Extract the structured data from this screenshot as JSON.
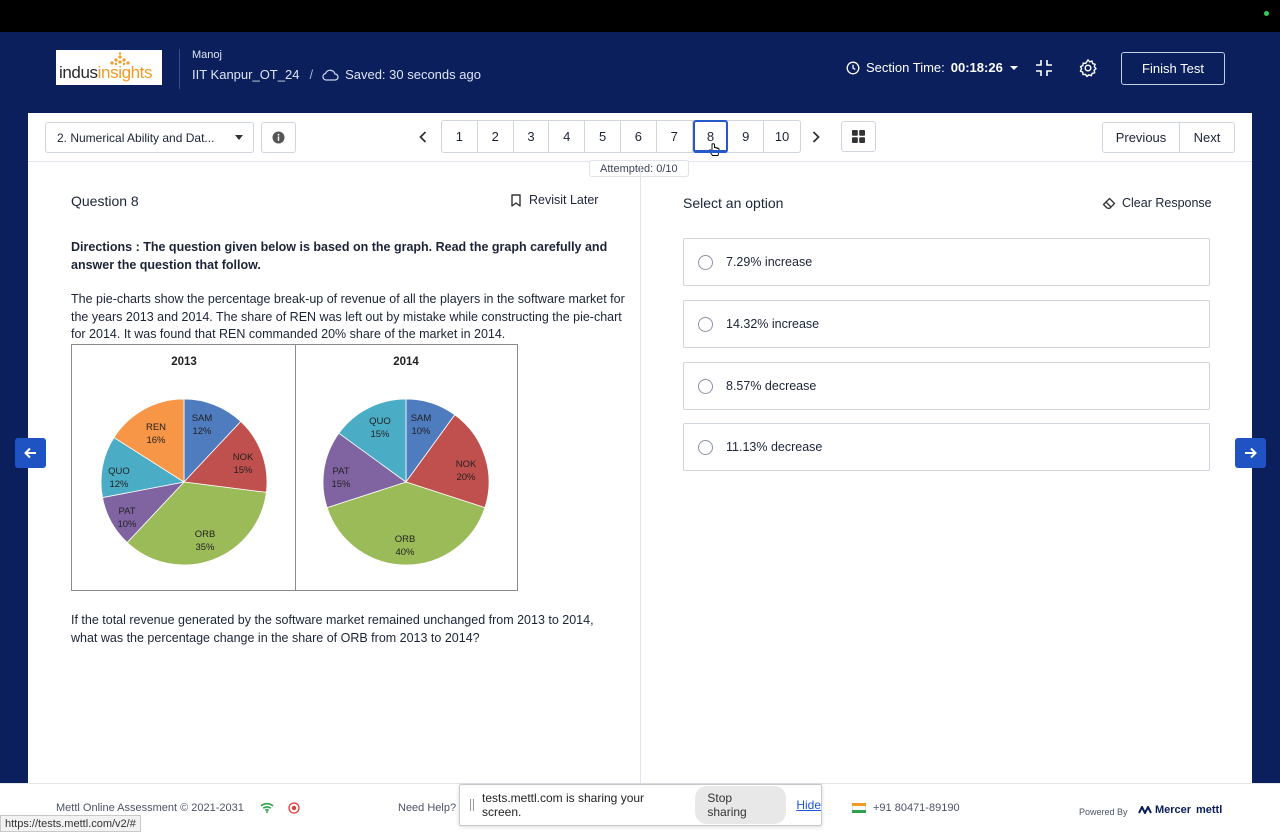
{
  "colors": {
    "header_bg": "#0a1f5c",
    "accent": "#2558c9",
    "side_arrow": "#1f53c3",
    "pie_sam": "#4f7bbf",
    "pie_nok": "#c0504d",
    "pie_orb": "#9bbb59",
    "pie_pat": "#8064a2",
    "pie_quo": "#4bacc6",
    "pie_ren": "#f79646"
  },
  "header": {
    "logo_part1": "indus",
    "logo_part2": "insights",
    "user_name": "Manoj",
    "test_name": "IIT Kanpur_OT_24",
    "separator": "/",
    "saved_status": "Saved: 30 seconds ago",
    "section_time_label": "Section Time:",
    "section_time_value": "00:18:26",
    "finish_label": "Finish Test"
  },
  "nav": {
    "section_select": "2. Numerical Ability and Dat...",
    "question_numbers": [
      "1",
      "2",
      "3",
      "4",
      "5",
      "6",
      "7",
      "8",
      "9",
      "10"
    ],
    "active_question": "8",
    "attempted": "Attempted: 0/10",
    "previous_label": "Previous",
    "next_label": "Next"
  },
  "question": {
    "title": "Question 8",
    "revisit_label": "Revisit Later",
    "directions": "Directions : The question given below is based on the graph. Read the graph carefully and answer the question that follow.",
    "paragraph": "The pie-charts show the percentage break-up of revenue of all the players in the software market for the years 2013 and 2014. The share of REN was left out by mistake while constructing the pie-chart for 2014. It was found that REN commanded 20% share of the market in 2014.",
    "prompt": "If the total revenue generated by the software market remained unchanged from 2013 to 2014, what was the percentage change in the share of ORB from 2013 to 2014?"
  },
  "chart_data": [
    {
      "type": "pie",
      "title": "2013",
      "slices": [
        {
          "label": "SAM",
          "value": 12,
          "text": "12%",
          "color": "#4f7bbf"
        },
        {
          "label": "NOK",
          "value": 15,
          "text": "15%",
          "color": "#c0504d"
        },
        {
          "label": "ORB",
          "value": 35,
          "text": "35%",
          "color": "#9bbb59"
        },
        {
          "label": "PAT",
          "value": 10,
          "text": "10%",
          "color": "#8064a2"
        },
        {
          "label": "QUO",
          "value": 12,
          "text": "12%",
          "color": "#4bacc6"
        },
        {
          "label": "REN",
          "value": 16,
          "text": "16%",
          "color": "#f79646"
        }
      ]
    },
    {
      "type": "pie",
      "title": "2014",
      "slices": [
        {
          "label": "SAM",
          "value": 10,
          "text": "10%",
          "color": "#4f7bbf"
        },
        {
          "label": "NOK",
          "value": 20,
          "text": "20%",
          "color": "#c0504d"
        },
        {
          "label": "ORB",
          "value": 40,
          "text": "40%",
          "color": "#9bbb59"
        },
        {
          "label": "PAT",
          "value": 15,
          "text": "15%",
          "color": "#8064a2"
        },
        {
          "label": "QUO",
          "value": 15,
          "text": "15%",
          "color": "#4bacc6"
        }
      ]
    }
  ],
  "options": {
    "title": "Select an option",
    "clear_label": "Clear Response",
    "items": [
      "7.29% increase",
      "14.32% increase",
      "8.57% decrease",
      "11.13% decrease"
    ]
  },
  "footer": {
    "copyright": "Mettl Online Assessment © 2021-2031",
    "help": "Need Help?",
    "phone": "+91 80471-89190",
    "powered": "Powered By",
    "mercer": "Mercer",
    "mettl": "mettl"
  },
  "share_bar": {
    "message": "tests.mettl.com is sharing your screen.",
    "stop_label": "Stop sharing",
    "hide_label": "Hide"
  },
  "url_tooltip": "https://tests.mettl.com/v2/#"
}
